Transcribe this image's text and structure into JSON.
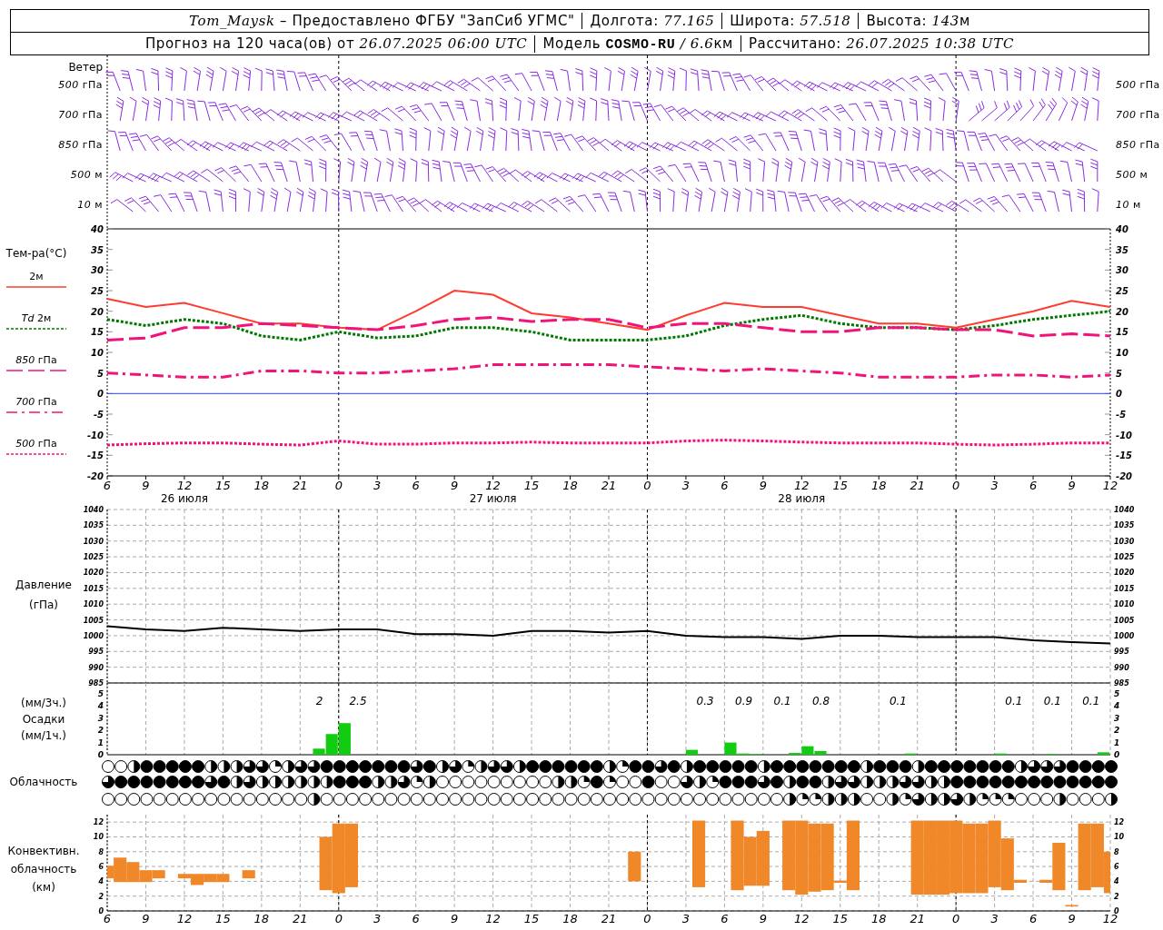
{
  "header": {
    "rows": [
      {
        "cells": [
          [
            {
              "text": "Tom_Maysk",
              "kind": "italic"
            },
            {
              "text": " – Предоставлено ФГБУ \"ЗапСиб УГМС\"",
              "kind": "plain"
            }
          ],
          [
            {
              "text": "Долгота: ",
              "kind": "plain"
            },
            {
              "text": "77.165",
              "kind": "italic"
            }
          ],
          [
            {
              "text": "Широта: ",
              "kind": "plain"
            },
            {
              "text": "57.518",
              "kind": "italic"
            }
          ],
          [
            {
              "text": "Высота: ",
              "kind": "plain"
            },
            {
              "text": "143",
              "kind": "italic"
            },
            {
              "text": "м",
              "kind": "plain"
            }
          ]
        ]
      },
      {
        "cells": [
          [
            {
              "text": "Прогноз на 120 часа(ов) от ",
              "kind": "plain"
            },
            {
              "text": "26.07.2025 06:00 UTC",
              "kind": "italic"
            }
          ],
          [
            {
              "text": "Модель ",
              "kind": "plain"
            },
            {
              "text": "COSMO-RU",
              "kind": "bold"
            },
            {
              "text": " / 6.6",
              "kind": "italic"
            },
            {
              "text": "км",
              "kind": "plain"
            }
          ],
          [
            {
              "text": "Рассчитано: ",
              "kind": "plain"
            },
            {
              "text": "26.07.2025 10:38 UTC",
              "kind": "italic"
            }
          ]
        ]
      }
    ]
  },
  "wind": {
    "title": "Ветер",
    "labels_left": [
      "*500* гПа",
      "*700* гПа",
      "*850* гПа",
      "*500* м",
      "*10* м"
    ],
    "labels_right": [
      "*500* гПа",
      "*700* гПа",
      "*850* гПа",
      "*500* м",
      "*10* м"
    ]
  },
  "temperature": {
    "days": [
      "26 июля",
      "27 июля",
      "28 июля"
    ],
    "left_ticks": [
      "40",
      "35",
      "30",
      "25",
      "20",
      "15",
      "10",
      "5",
      "0",
      "-5",
      "-10",
      "-15",
      "-20"
    ],
    "chart_data": {
      "type": "line",
      "ylabel": "Тем-ра(°C)",
      "categories": [
        "6",
        "9",
        "12",
        "15",
        "18",
        "21",
        "0",
        "3",
        "6",
        "9",
        "12",
        "15",
        "18",
        "21",
        "0",
        "3",
        "6",
        "9",
        "12",
        "15",
        "18",
        "21",
        "0",
        "3",
        "6",
        "9",
        "12"
      ],
      "ylim": [
        -20,
        40
      ],
      "yticks": [
        -20,
        -15,
        -10,
        -5,
        0,
        5,
        10,
        15,
        20,
        25,
        30,
        35,
        40
      ],
      "grid": true,
      "ref_lines": [
        {
          "axis": "y",
          "value": 0
        }
      ],
      "series": [
        {
          "name": "2м",
          "color": "#ff3b30",
          "line_style": "solid",
          "values": [
            23,
            21,
            22,
            19.5,
            17,
            17,
            16,
            15.5,
            20,
            25,
            24,
            19.5,
            18.5,
            17,
            15.5,
            19,
            22,
            21,
            21,
            19,
            17,
            17,
            16,
            18,
            20,
            22.5,
            21
          ]
        },
        {
          "name": "*Td* 2м",
          "color": "#007800",
          "line_style": "dotted",
          "values": [
            18,
            16.5,
            18,
            17,
            14,
            13,
            15,
            13.5,
            14,
            16,
            16,
            15,
            13,
            13,
            13,
            14,
            16.5,
            18,
            19,
            17,
            16,
            16,
            15.5,
            16.5,
            18,
            19,
            20
          ]
        },
        {
          "name": "*850* гПа",
          "color": "#f0147a",
          "line_style": "dashed",
          "values": [
            13,
            13.5,
            16,
            16,
            17,
            16.5,
            16,
            15.5,
            16.5,
            18,
            18.5,
            17.5,
            18,
            18,
            16,
            17,
            17,
            16,
            15,
            15,
            16,
            16,
            15.5,
            15.5,
            14,
            14.5,
            14
          ]
        },
        {
          "name": "*700* гПа",
          "color": "#f0147a",
          "line_style": "dashdot",
          "values": [
            5,
            4.5,
            4,
            4,
            5.5,
            5.5,
            5,
            5,
            5.5,
            6,
            7,
            7,
            7,
            7,
            6.5,
            6,
            5.5,
            6,
            5.5,
            5,
            4,
            4,
            4,
            4.5,
            4.5,
            4,
            4.5
          ]
        },
        {
          "name": "*500* гПа",
          "color": "#f0147a",
          "line_style": "dotted",
          "values": [
            -12.5,
            -12.2,
            -12,
            -12,
            -12.3,
            -12.5,
            -11.5,
            -12.3,
            -12.3,
            -12,
            -12,
            -11.8,
            -12,
            -12,
            -12,
            -11.5,
            -11.3,
            -11.5,
            -11.8,
            -12,
            -12,
            -12,
            -12.3,
            -12.5,
            -12.3,
            -12,
            -12
          ]
        }
      ]
    }
  },
  "pressure": {
    "right_ticks": [
      "1040",
      "1035",
      "1030",
      "1025",
      "1020",
      "1015",
      "1010",
      "1005",
      "1000",
      "995",
      "990",
      "985"
    ],
    "chart_data": {
      "type": "line",
      "ylabel": "Давление (гПа)",
      "grid": true,
      "categories": [
        null,
        null,
        null,
        null,
        null,
        null,
        null,
        null,
        null,
        null,
        null,
        null,
        null,
        null,
        null,
        null,
        null,
        null,
        null,
        null,
        null,
        null,
        null,
        null,
        null,
        null,
        null
      ],
      "ylim": [
        985,
        1040
      ],
      "yticks": [
        985,
        990,
        995,
        1000,
        1005,
        1010,
        1015,
        1020,
        1025,
        1030,
        1035,
        1040
      ],
      "series": [
        {
          "color": "#000000",
          "values": [
            1003,
            1002,
            1001.5,
            1002.5,
            1002,
            1001.5,
            1002,
            1002,
            1000.5,
            1000.5,
            1000,
            1001.5,
            1001.5,
            1001,
            1001.5,
            1000,
            999.5,
            999.5,
            999,
            1000,
            1000,
            999.5,
            999.5,
            999.5,
            998.5,
            998,
            997.5
          ]
        }
      ]
    }
  },
  "precipitation": {
    "right_ticks": [
      "5",
      "4",
      "3",
      "2",
      "1",
      "0"
    ],
    "chart_data": {
      "type": "bar",
      "ylabel": "(мм/3ч.) Осадки (мм/1ч.)",
      "grid": true,
      "value_labels": [
        null,
        null,
        null,
        null,
        null,
        null,
        null,
        null,
        null,
        null,
        null,
        null,
        null,
        null,
        null,
        null,
        "2",
        null,
        null,
        "2.5",
        null,
        null,
        null,
        null,
        null,
        null,
        null,
        null,
        null,
        null,
        null,
        null,
        null,
        null,
        null,
        null,
        null,
        null,
        null,
        null,
        null,
        null,
        null,
        null,
        null,
        null,
        "0.3",
        null,
        null,
        "0.9",
        null,
        null,
        "0.1",
        null,
        null,
        "0.8",
        null,
        null,
        null,
        null,
        null,
        "0.1",
        null,
        null,
        null,
        null,
        null,
        null,
        null,
        null,
        "0.1",
        null,
        null,
        "0.1",
        null,
        null,
        "0.1",
        null
      ],
      "ylim": [
        0,
        5.9
      ],
      "yticks": [
        0,
        1,
        2,
        3,
        4,
        5
      ],
      "categories": [
        null,
        null,
        null,
        null,
        null,
        null,
        null,
        null,
        null,
        null,
        null,
        null,
        null,
        null,
        null,
        null,
        null,
        null,
        null,
        null,
        null,
        null,
        null,
        null,
        null,
        null,
        null,
        null,
        null,
        null,
        null,
        null,
        null,
        null,
        null,
        null,
        null,
        null,
        null,
        null,
        null,
        null,
        null,
        null,
        null,
        null,
        null,
        null,
        null,
        null,
        null,
        null,
        null,
        null,
        null,
        null,
        null,
        null,
        null,
        null,
        null,
        null,
        null,
        null,
        null,
        null,
        null,
        null,
        null,
        null,
        null,
        null,
        null,
        null,
        null,
        null,
        null,
        null
      ],
      "series": [
        {
          "color": "#11cc11",
          "values": [
            null,
            null,
            null,
            null,
            null,
            null,
            null,
            null,
            null,
            null,
            null,
            null,
            null,
            null,
            null,
            null,
            0.5,
            1.7,
            2.6,
            null,
            null,
            null,
            null,
            null,
            null,
            null,
            null,
            null,
            null,
            null,
            null,
            null,
            null,
            null,
            null,
            null,
            null,
            null,
            null,
            null,
            null,
            null,
            null,
            null,
            null,
            0.4,
            null,
            null,
            1.0,
            0.1,
            0.05,
            null,
            null,
            0.15,
            0.7,
            0.3,
            null,
            null,
            null,
            null,
            null,
            null,
            0.1,
            null,
            null,
            null,
            null,
            null,
            null,
            0.1,
            null,
            null,
            null,
            0.05,
            null,
            null,
            null,
            0.2
          ]
        }
      ]
    }
  },
  "clouds": {
    "label": "Облачность",
    "rows": [
      {
        "cells": [
          {
            "kind": "clear"
          },
          {
            "kind": "clear"
          },
          {
            "kind": "half"
          },
          {
            "kind": "overcast"
          },
          {
            "kind": "overcast"
          },
          {
            "kind": "overcast"
          },
          {
            "kind": "overcast"
          },
          {
            "kind": "overcast"
          },
          {
            "kind": "half"
          },
          {
            "kind": "half"
          },
          {
            "kind": "half"
          },
          {
            "kind": "most"
          },
          {
            "kind": "most"
          },
          {
            "kind": "quarter"
          },
          {
            "kind": "half"
          },
          {
            "kind": "most"
          },
          {
            "kind": "most"
          },
          {
            "kind": "overcast"
          },
          {
            "kind": "overcast"
          },
          {
            "kind": "overcast"
          },
          {
            "kind": "overcast"
          },
          {
            "kind": "overcast"
          },
          {
            "kind": "overcast"
          },
          {
            "kind": "overcast"
          },
          {
            "kind": "most"
          },
          {
            "kind": "overcast"
          },
          {
            "kind": "half"
          },
          {
            "kind": "most"
          },
          {
            "kind": "quarter"
          },
          {
            "kind": "half"
          },
          {
            "kind": "most"
          },
          {
            "kind": "most"
          },
          {
            "kind": "half"
          },
          {
            "kind": "overcast"
          },
          {
            "kind": "overcast"
          },
          {
            "kind": "overcast"
          },
          {
            "kind": "overcast"
          },
          {
            "kind": "overcast"
          },
          {
            "kind": "overcast"
          },
          {
            "kind": "half"
          },
          {
            "kind": "quarter"
          },
          {
            "kind": "overcast"
          },
          {
            "kind": "overcast"
          },
          {
            "kind": "most"
          },
          {
            "kind": "overcast"
          },
          {
            "kind": "half"
          },
          {
            "kind": "overcast"
          },
          {
            "kind": "overcast"
          },
          {
            "kind": "overcast"
          },
          {
            "kind": "overcast"
          },
          {
            "kind": "overcast"
          },
          {
            "kind": "half"
          },
          {
            "kind": "overcast"
          },
          {
            "kind": "overcast"
          },
          {
            "kind": "overcast"
          },
          {
            "kind": "overcast"
          },
          {
            "kind": "overcast"
          },
          {
            "kind": "overcast"
          },
          {
            "kind": "overcast"
          },
          {
            "kind": "half"
          },
          {
            "kind": "overcast"
          },
          {
            "kind": "overcast"
          },
          {
            "kind": "overcast"
          },
          {
            "kind": "half"
          },
          {
            "kind": "overcast"
          },
          {
            "kind": "overcast"
          },
          {
            "kind": "overcast"
          },
          {
            "kind": "overcast"
          },
          {
            "kind": "overcast"
          },
          {
            "kind": "overcast"
          },
          {
            "kind": "overcast"
          },
          {
            "kind": "half"
          },
          {
            "kind": "most"
          },
          {
            "kind": "most"
          },
          {
            "kind": "most"
          },
          {
            "kind": "overcast"
          },
          {
            "kind": "overcast"
          },
          {
            "kind": "overcast"
          },
          {
            "kind": "overcast"
          }
        ]
      },
      {
        "cells": [
          {
            "kind": "most"
          },
          {
            "kind": "overcast"
          },
          {
            "kind": "overcast"
          },
          {
            "kind": "overcast"
          },
          {
            "kind": "overcast"
          },
          {
            "kind": "overcast"
          },
          {
            "kind": "overcast"
          },
          {
            "kind": "overcast"
          },
          {
            "kind": "most"
          },
          {
            "kind": "overcast"
          },
          {
            "kind": "half"
          },
          {
            "kind": "most"
          },
          {
            "kind": "half"
          },
          {
            "kind": "half"
          },
          {
            "kind": "half"
          },
          {
            "kind": "half"
          },
          {
            "kind": "half"
          },
          {
            "kind": "half"
          },
          {
            "kind": "overcast"
          },
          {
            "kind": "overcast"
          },
          {
            "kind": "overcast"
          },
          {
            "kind": "half"
          },
          {
            "kind": "half"
          },
          {
            "kind": "most"
          },
          {
            "kind": "quarter"
          },
          {
            "kind": "half"
          },
          {
            "kind": "clear"
          },
          {
            "kind": "clear"
          },
          {
            "kind": "clear"
          },
          {
            "kind": "clear"
          },
          {
            "kind": "clear"
          },
          {
            "kind": "clear"
          },
          {
            "kind": "clear"
          },
          {
            "kind": "clear"
          },
          {
            "kind": "clear"
          },
          {
            "kind": "half"
          },
          {
            "kind": "half"
          },
          {
            "kind": "quarter"
          },
          {
            "kind": "overcast"
          },
          {
            "kind": "quarter"
          },
          {
            "kind": "clear"
          },
          {
            "kind": "clear"
          },
          {
            "kind": "overcast"
          },
          {
            "kind": "clear"
          },
          {
            "kind": "clear"
          },
          {
            "kind": "most"
          },
          {
            "kind": "half"
          },
          {
            "kind": "quarter"
          },
          {
            "kind": "overcast"
          },
          {
            "kind": "overcast"
          },
          {
            "kind": "overcast"
          },
          {
            "kind": "most"
          },
          {
            "kind": "overcast"
          },
          {
            "kind": "half"
          },
          {
            "kind": "overcast"
          },
          {
            "kind": "overcast"
          },
          {
            "kind": "half"
          },
          {
            "kind": "most"
          },
          {
            "kind": "most"
          },
          {
            "kind": "half"
          },
          {
            "kind": "half"
          },
          {
            "kind": "half"
          },
          {
            "kind": "most"
          },
          {
            "kind": "most"
          },
          {
            "kind": "half"
          },
          {
            "kind": "half"
          },
          {
            "kind": "overcast"
          },
          {
            "kind": "overcast"
          },
          {
            "kind": "overcast"
          },
          {
            "kind": "overcast"
          },
          {
            "kind": "overcast"
          },
          {
            "kind": "overcast"
          },
          {
            "kind": "overcast"
          },
          {
            "kind": "overcast"
          },
          {
            "kind": "overcast"
          },
          {
            "kind": "overcast"
          },
          {
            "kind": "overcast"
          },
          {
            "kind": "overcast"
          },
          {
            "kind": "overcast"
          }
        ]
      },
      {
        "cells": [
          {
            "kind": "clear"
          },
          {
            "kind": "clear"
          },
          {
            "kind": "clear"
          },
          {
            "kind": "clear"
          },
          {
            "kind": "clear"
          },
          {
            "kind": "clear"
          },
          {
            "kind": "clear"
          },
          {
            "kind": "clear"
          },
          {
            "kind": "clear"
          },
          {
            "kind": "clear"
          },
          {
            "kind": "clear"
          },
          {
            "kind": "clear"
          },
          {
            "kind": "clear"
          },
          {
            "kind": "clear"
          },
          {
            "kind": "clear"
          },
          {
            "kind": "clear"
          },
          {
            "kind": "half"
          },
          {
            "kind": "clear"
          },
          {
            "kind": "clear"
          },
          {
            "kind": "clear"
          },
          {
            "kind": "clear"
          },
          {
            "kind": "clear"
          },
          {
            "kind": "clear"
          },
          {
            "kind": "clear"
          },
          {
            "kind": "clear"
          },
          {
            "kind": "clear"
          },
          {
            "kind": "clear"
          },
          {
            "kind": "clear"
          },
          {
            "kind": "clear"
          },
          {
            "kind": "clear"
          },
          {
            "kind": "clear"
          },
          {
            "kind": "clear"
          },
          {
            "kind": "clear"
          },
          {
            "kind": "clear"
          },
          {
            "kind": "clear"
          },
          {
            "kind": "clear"
          },
          {
            "kind": "clear"
          },
          {
            "kind": "clear"
          },
          {
            "kind": "clear"
          },
          {
            "kind": "clear"
          },
          {
            "kind": "clear"
          },
          {
            "kind": "clear"
          },
          {
            "kind": "clear"
          },
          {
            "kind": "clear"
          },
          {
            "kind": "clear"
          },
          {
            "kind": "clear"
          },
          {
            "kind": "clear"
          },
          {
            "kind": "clear"
          },
          {
            "kind": "clear"
          },
          {
            "kind": "clear"
          },
          {
            "kind": "clear"
          },
          {
            "kind": "clear"
          },
          {
            "kind": "clear"
          },
          {
            "kind": "half"
          },
          {
            "kind": "quarter"
          },
          {
            "kind": "quarter"
          },
          {
            "kind": "half"
          },
          {
            "kind": "half"
          },
          {
            "kind": "half"
          },
          {
            "kind": "clear"
          },
          {
            "kind": "clear"
          },
          {
            "kind": "half"
          },
          {
            "kind": "quarter"
          },
          {
            "kind": "most"
          },
          {
            "kind": "half"
          },
          {
            "kind": "half"
          },
          {
            "kind": "most"
          },
          {
            "kind": "half"
          },
          {
            "kind": "quarter"
          },
          {
            "kind": "quarter"
          },
          {
            "kind": "quarter"
          },
          {
            "kind": "clear"
          },
          {
            "kind": "clear"
          },
          {
            "kind": "clear"
          },
          {
            "kind": "half"
          },
          {
            "kind": "clear"
          },
          {
            "kind": "clear"
          },
          {
            "kind": "clear"
          },
          {
            "kind": "half"
          }
        ]
      }
    ]
  },
  "convective": {
    "right_ticks": [
      "12",
      "10",
      "8",
      "6",
      "4",
      "2",
      "0"
    ],
    "chart_data": {
      "type": "candlestick",
      "color": "#f0882a",
      "ylabel": "Конвективн. облачность (км)",
      "grid": true,
      "ylim": [
        0,
        13
      ],
      "yticks": [
        0,
        2,
        4,
        6,
        8,
        10,
        12
      ],
      "categories": [
        "6",
        null,
        null,
        "9",
        null,
        null,
        "12",
        null,
        null,
        "15",
        null,
        null,
        "18",
        null,
        null,
        "21",
        null,
        null,
        "0",
        null,
        null,
        "3",
        null,
        null,
        "6",
        null,
        null,
        "9",
        null,
        null,
        "12",
        null,
        null,
        "15",
        null,
        null,
        "18",
        null,
        null,
        "21",
        null,
        null,
        "0",
        null,
        null,
        "3",
        null,
        null,
        "6",
        null,
        null,
        "9",
        null,
        null,
        "12",
        null,
        null,
        "15",
        null,
        null,
        "18",
        null,
        null,
        "21",
        null,
        null,
        "0",
        null,
        null,
        "3",
        null,
        null,
        "6",
        null,
        null,
        "9",
        null,
        null,
        "12"
      ],
      "ohlc": [
        [
          4.4,
          6.1,
          4.4,
          6.1
        ],
        [
          3.9,
          7.2,
          3.9,
          7.2
        ],
        [
          3.9,
          6.6,
          3.9,
          6.6
        ],
        [
          3.9,
          5.5,
          3.9,
          5.5
        ],
        [
          4.4,
          5.5,
          4.4,
          5.5
        ],
        null,
        [
          4.4,
          5.0,
          4.4,
          5.0
        ],
        [
          3.5,
          5.0,
          3.5,
          5.0
        ],
        [
          3.9,
          5.0,
          3.9,
          5.0
        ],
        [
          3.9,
          5.0,
          3.9,
          5.0
        ],
        null,
        [
          4.4,
          5.5,
          4.4,
          5.5
        ],
        null,
        null,
        null,
        null,
        null,
        [
          2.8,
          10,
          2.8,
          10
        ],
        [
          2.4,
          11.8,
          2.4,
          11.8
        ],
        [
          3.2,
          11.8,
          3.2,
          11.8
        ],
        null,
        null,
        null,
        null,
        null,
        null,
        null,
        null,
        null,
        null,
        null,
        null,
        null,
        null,
        null,
        null,
        null,
        null,
        null,
        null,
        null,
        [
          4,
          8,
          4,
          8
        ],
        null,
        null,
        null,
        null,
        [
          3.2,
          12.2,
          3.2,
          12.2
        ],
        null,
        null,
        [
          2.8,
          12.2,
          2.8,
          12.2
        ],
        [
          3.4,
          10,
          3.4,
          10
        ],
        [
          3.4,
          10.8,
          3.4,
          10.8
        ],
        null,
        [
          2.8,
          12.2,
          2.8,
          12.2
        ],
        [
          2.2,
          12.2,
          2.2,
          12.2
        ],
        [
          2.6,
          11.8,
          2.6,
          11.8
        ],
        [
          2.8,
          11.8,
          2.8,
          11.8
        ],
        [
          3.8,
          4.1,
          3.8,
          4.1
        ],
        [
          2.8,
          12.2,
          2.8,
          12.2
        ],
        null,
        null,
        null,
        null,
        [
          2.2,
          12.2,
          2.2,
          12.2
        ],
        [
          2.2,
          12.2,
          2.2,
          12.2
        ],
        [
          2.2,
          12.2,
          2.2,
          12.2
        ],
        [
          2.4,
          12.2,
          2.4,
          12.2
        ],
        [
          2.4,
          11.8,
          2.4,
          11.8
        ],
        [
          2.4,
          11.8,
          2.4,
          11.8
        ],
        [
          3.2,
          12.2,
          3.2,
          12.2
        ],
        [
          2.8,
          9.8,
          2.8,
          9.8
        ],
        [
          3.8,
          4.2,
          3.8,
          4.2
        ],
        null,
        [
          3.8,
          4.2,
          3.8,
          4.2
        ],
        [
          2.8,
          9.2,
          2.8,
          9.2
        ],
        [
          0.6,
          0.8,
          0.6,
          0.8
        ],
        [
          2.8,
          11.8,
          2.8,
          11.8
        ],
        [
          3.2,
          11.8,
          3.2,
          11.8
        ],
        [
          2.4,
          8,
          2.4,
          8
        ]
      ]
    }
  }
}
